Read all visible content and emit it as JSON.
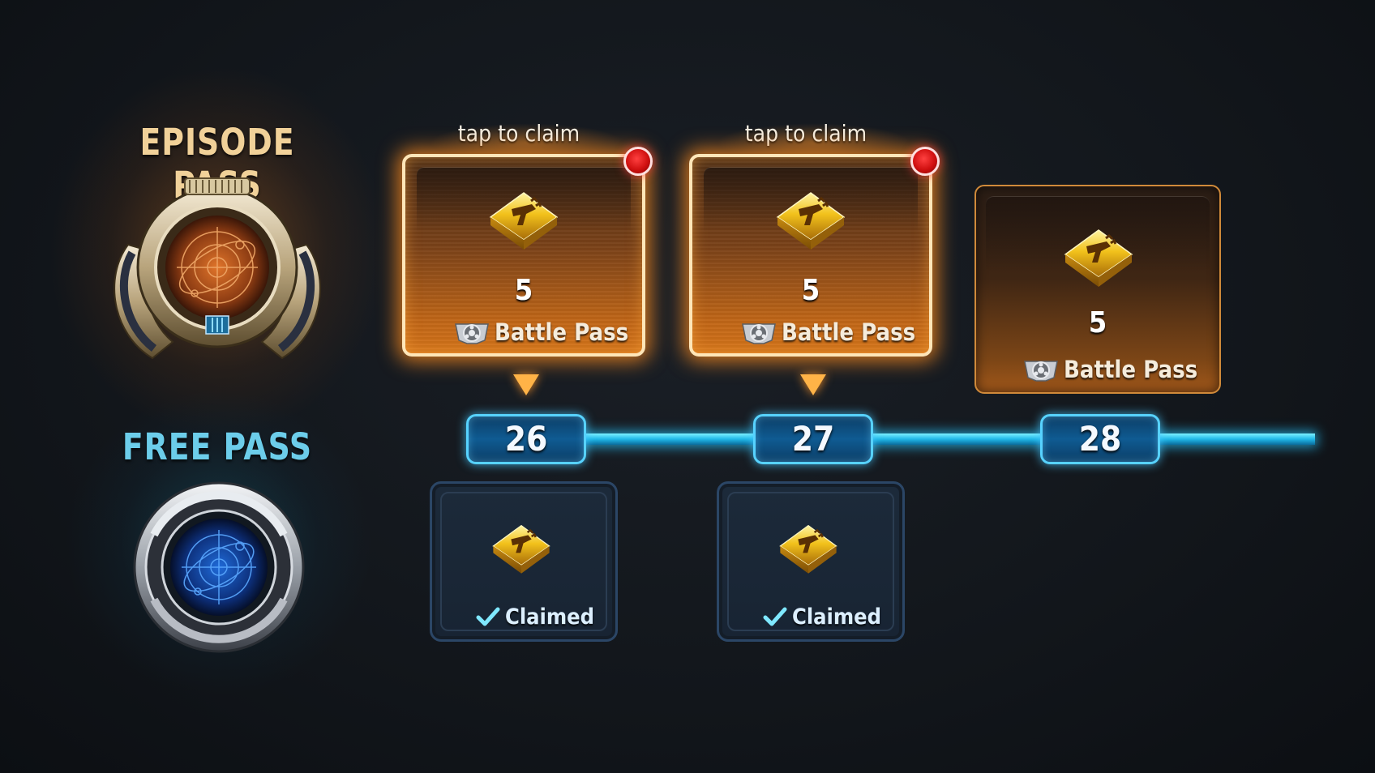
{
  "episode_pass": {
    "title": "EPISODE PASS",
    "emblem_icon": "episode-pass-emblem-icon"
  },
  "free_pass": {
    "title": "FREE PASS",
    "emblem_icon": "free-pass-emblem-icon"
  },
  "colors": {
    "episode_accent": "#f1d199",
    "free_accent": "#6ccdea",
    "track": "#1fb8e8",
    "notification": "#d01010"
  },
  "levels": [
    {
      "level": "26",
      "premium": {
        "hint": "tap to claim",
        "amount": "5",
        "pass_label": "Battle Pass",
        "icon": "reward-crystal-icon"
      },
      "free": {
        "status": "Claimed",
        "icon": "reward-crystal-icon"
      }
    },
    {
      "level": "27",
      "premium": {
        "hint": "tap to claim",
        "amount": "5",
        "pass_label": "Battle Pass",
        "icon": "reward-crystal-icon"
      },
      "free": {
        "status": "Claimed",
        "icon": "reward-crystal-icon"
      }
    },
    {
      "level": "28",
      "premium": {
        "amount": "5",
        "pass_label": "Battle Pass",
        "icon": "reward-crystal-icon"
      }
    }
  ]
}
